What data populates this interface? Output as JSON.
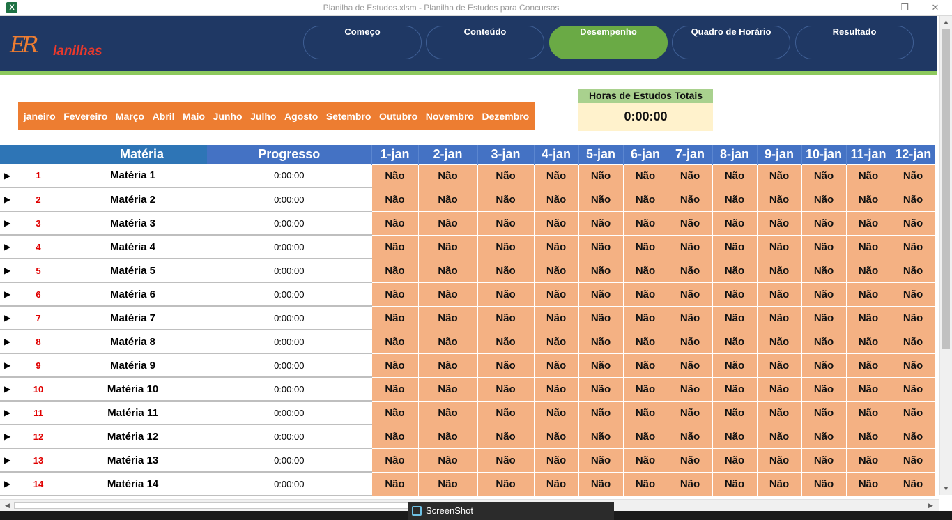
{
  "window": {
    "title": "Planilha de Estudos.xlsm - Planilha de Estudos para Concursos",
    "app_icon": "X"
  },
  "logo": {
    "mark": "ER",
    "word": "lanilhas"
  },
  "nav": {
    "items": [
      {
        "label": "Começo"
      },
      {
        "label": "Conteúdo"
      },
      {
        "label": "Desempenho"
      },
      {
        "label": "Quadro de Horário"
      },
      {
        "label": "Resultado"
      }
    ],
    "active": "Desempenho"
  },
  "months": [
    "janeiro",
    "Fevereiro",
    "Março",
    "Abril",
    "Maio",
    "Junho",
    "Julho",
    "Agosto",
    "Setembro",
    "Outubro",
    "Novembro",
    "Dezembro"
  ],
  "totals": {
    "label": "Horas de Estudos Totais",
    "value": "0:00:00"
  },
  "table": {
    "headers": {
      "materia": "Matéria",
      "progresso": "Progresso"
    },
    "dates": [
      "1-jan",
      "2-jan",
      "3-jan",
      "4-jan",
      "5-jan",
      "6-jan",
      "7-jan",
      "8-jan",
      "9-jan",
      "10-jan",
      "11-jan",
      "12-jan"
    ],
    "arrow": "▶",
    "rows": [
      {
        "num": "1",
        "name": "Matéria 1",
        "progress": "0:00:00"
      },
      {
        "num": "2",
        "name": "Matéria 2",
        "progress": "0:00:00"
      },
      {
        "num": "3",
        "name": "Matéria 3",
        "progress": "0:00:00"
      },
      {
        "num": "4",
        "name": "Matéria 4",
        "progress": "0:00:00"
      },
      {
        "num": "5",
        "name": "Matéria 5",
        "progress": "0:00:00"
      },
      {
        "num": "6",
        "name": "Matéria 6",
        "progress": "0:00:00"
      },
      {
        "num": "7",
        "name": "Matéria 7",
        "progress": "0:00:00"
      },
      {
        "num": "8",
        "name": "Matéria 8",
        "progress": "0:00:00"
      },
      {
        "num": "9",
        "name": "Matéria 9",
        "progress": "0:00:00"
      },
      {
        "num": "10",
        "name": "Matéria 10",
        "progress": "0:00:00"
      },
      {
        "num": "11",
        "name": "Matéria 11",
        "progress": "0:00:00"
      },
      {
        "num": "12",
        "name": "Matéria 12",
        "progress": "0:00:00"
      },
      {
        "num": "13",
        "name": "Matéria 13",
        "progress": "0:00:00"
      },
      {
        "num": "14",
        "name": "Matéria 14",
        "progress": "0:00:00"
      }
    ],
    "cell_value": "Não"
  },
  "taskbar": {
    "popup_label": "ScreenShot"
  },
  "colors": {
    "header_bg": "#1f3864",
    "accent_green": "#6aaa45",
    "months_orange": "#ed7d31",
    "cell_salmon": "#f4b183",
    "table_header_blue": "#4472c4",
    "number_red": "#e00000"
  }
}
